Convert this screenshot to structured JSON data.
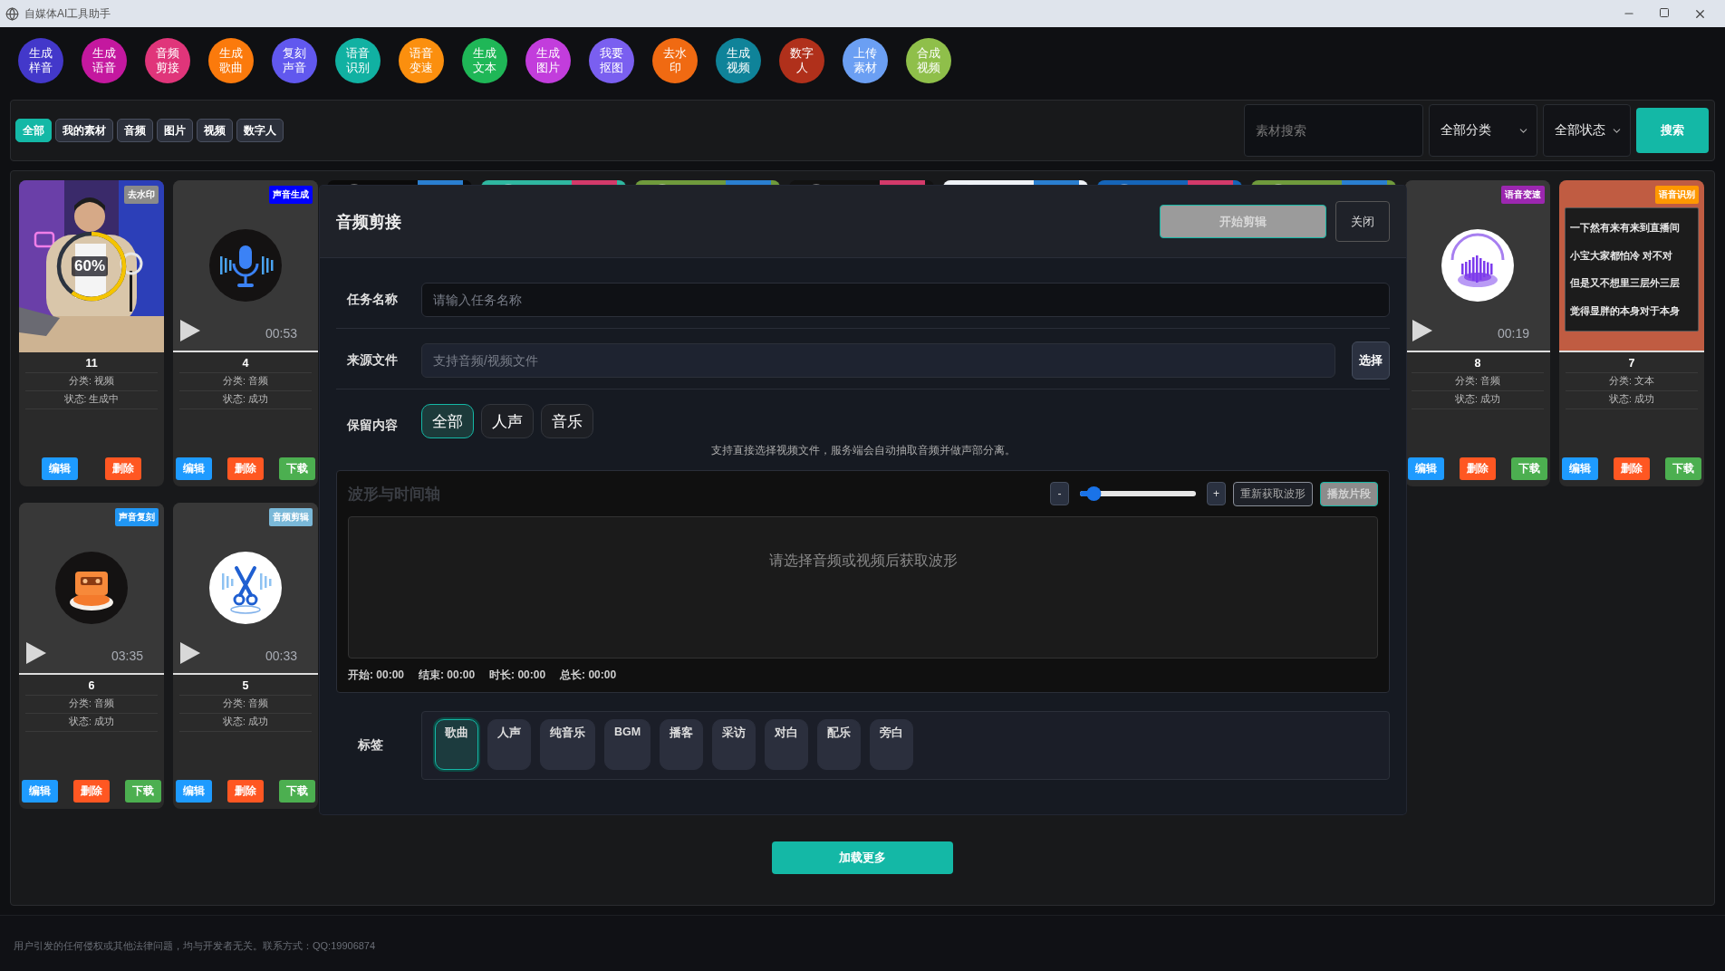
{
  "window": {
    "title": "自媒体AI工具助手"
  },
  "tools": [
    {
      "label": "生成样音",
      "color": "#4338ca"
    },
    {
      "label": "生成语音",
      "color": "#c4189f"
    },
    {
      "label": "音频剪接",
      "color": "#e0357a"
    },
    {
      "label": "生成歌曲",
      "color": "#fb7a0c"
    },
    {
      "label": "复刻声音",
      "color": "#6158ee"
    },
    {
      "label": "语音识别",
      "color": "#11b1a2"
    },
    {
      "label": "语音变速",
      "color": "#fb8f0e"
    },
    {
      "label": "生成文本",
      "color": "#1fb757"
    },
    {
      "label": "生成图片",
      "color": "#c23ddc"
    },
    {
      "label": "我要抠图",
      "color": "#7a5ff0"
    },
    {
      "label": "去水印",
      "color": "#f06a12"
    },
    {
      "label": "生成视频",
      "color": "#0f8399"
    },
    {
      "label": "数字人",
      "color": "#b0301b"
    },
    {
      "label": "上传素材",
      "color": "#6b9ff3"
    },
    {
      "label": "合成视频",
      "color": "#8fbf4a"
    }
  ],
  "filters": [
    {
      "label": "全部",
      "selected": true
    },
    {
      "label": "我的素材",
      "selected": false
    },
    {
      "label": "音频",
      "selected": false
    },
    {
      "label": "图片",
      "selected": false
    },
    {
      "label": "视频",
      "selected": false
    },
    {
      "label": "数字人",
      "selected": false
    }
  ],
  "search": {
    "placeholder": "素材搜索",
    "category": "全部分类",
    "status": "全部状态",
    "button": "搜索"
  },
  "cards": [
    {
      "kind": "video",
      "title": "11",
      "category": "分类: 视频",
      "status": "状态: 生成中",
      "badge": {
        "label": "去水印",
        "color": "#8a8a8a"
      },
      "progress": {
        "level": 0.6,
        "label": "60%"
      },
      "actions": [
        {
          "kind": "edit",
          "label": "编辑"
        },
        {
          "kind": "delete",
          "label": "删除"
        }
      ]
    },
    {
      "kind": "audio",
      "art": {
        "kind": "microphone"
      },
      "duration": "00:53",
      "title": "4",
      "category": "分类: 音频",
      "status": "状态: 成功",
      "badge": {
        "label": "声音生成",
        "color": "#0000ff"
      },
      "actions": [
        {
          "kind": "edit",
          "label": "编辑"
        },
        {
          "kind": "delete",
          "label": "删除"
        },
        {
          "kind": "download",
          "label": "下载"
        }
      ]
    },
    {
      "kind": "covered"
    },
    {
      "kind": "covered"
    },
    {
      "kind": "covered"
    },
    {
      "kind": "covered"
    },
    {
      "kind": "covered"
    },
    {
      "kind": "covered"
    },
    {
      "kind": "covered"
    },
    {
      "kind": "audio",
      "art": {
        "kind": "speed"
      },
      "duration": "00:19",
      "title": "8",
      "category": "分类: 音频",
      "status": "状态: 成功",
      "badge": {
        "label": "语音变速",
        "color": "#9c27b0"
      },
      "actions": [
        {
          "kind": "edit",
          "label": "编辑"
        },
        {
          "kind": "delete",
          "label": "删除"
        },
        {
          "kind": "download",
          "label": "下载"
        }
      ]
    },
    {
      "kind": "text",
      "lines": [
        "一下然有来有来到直播间",
        "小宝大家都怕冷 对不对",
        "但是又不想里三层外三层",
        "觉得显胖的本身对于本身"
      ],
      "title": "7",
      "category": "分类: 文本",
      "status": "状态: 成功",
      "badge": {
        "label": "语音识别",
        "color": "#ff9800"
      },
      "actions": [
        {
          "kind": "edit",
          "label": "编辑"
        },
        {
          "kind": "delete",
          "label": "删除"
        },
        {
          "kind": "download",
          "label": "下载"
        }
      ]
    },
    {
      "kind": "audio",
      "art": {
        "kind": "cassette"
      },
      "duration": "03:35",
      "title": "6",
      "category": "分类: 音频",
      "status": "状态: 成功",
      "badge": {
        "label": "声音复刻",
        "color": "#2196f3"
      },
      "actions": [
        {
          "kind": "edit",
          "label": "编辑"
        },
        {
          "kind": "delete",
          "label": "删除"
        },
        {
          "kind": "download",
          "label": "下载"
        }
      ]
    },
    {
      "kind": "audio",
      "art": {
        "kind": "scissors"
      },
      "duration": "00:33",
      "title": "5",
      "category": "分类: 音频",
      "status": "状态: 成功",
      "badge": {
        "label": "音频剪辑",
        "color": "#7ab8d8"
      },
      "actions": [
        {
          "kind": "edit",
          "label": "编辑"
        },
        {
          "kind": "delete",
          "label": "删除"
        },
        {
          "kind": "download",
          "label": "下载"
        }
      ]
    }
  ],
  "dialog": {
    "title": "音频剪接",
    "start": {
      "label": "开始剪辑",
      "disabled": true
    },
    "close": "关闭",
    "task": {
      "label": "任务名称",
      "placeholder": "请输入任务名称"
    },
    "source": {
      "label": "来源文件",
      "placeholder": "支持音频/视频文件",
      "button": "选择"
    },
    "keep": {
      "label": "保留内容",
      "options": [
        {
          "label": "全部",
          "selected": true
        },
        {
          "label": "人声",
          "selected": false
        },
        {
          "label": "音乐",
          "selected": false
        }
      ],
      "hint": "支持直接选择视频文件，服务端会自动抽取音频并做声部分离。"
    },
    "waveform": {
      "title": "波形与时间轴",
      "zoom_out": "-",
      "zoom_in": "+",
      "zoom": {
        "level": 0.12
      },
      "refresh": "重新获取波形",
      "play": {
        "label": "播放片段",
        "disabled": true
      },
      "empty": "请选择音频或视频后获取波形",
      "times": [
        "开始: 00:00",
        "结束: 00:00",
        "时长: 00:00",
        "总长: 00:00"
      ]
    },
    "tags": {
      "label": "标签",
      "items": [
        {
          "label": "歌曲",
          "selected": true
        },
        {
          "label": "人声",
          "selected": false
        },
        {
          "label": "纯音乐",
          "selected": false
        },
        {
          "label": "BGM",
          "selected": false
        },
        {
          "label": "播客",
          "selected": false
        },
        {
          "label": "采访",
          "selected": false
        },
        {
          "label": "对白",
          "selected": false
        },
        {
          "label": "配乐",
          "selected": false
        },
        {
          "label": "旁白",
          "selected": false
        }
      ]
    }
  },
  "load_more": "加载更多",
  "footer": "用户引发的任何侵权或其他法律问题，均与开发者无关。联系方式：QQ:19906874"
}
